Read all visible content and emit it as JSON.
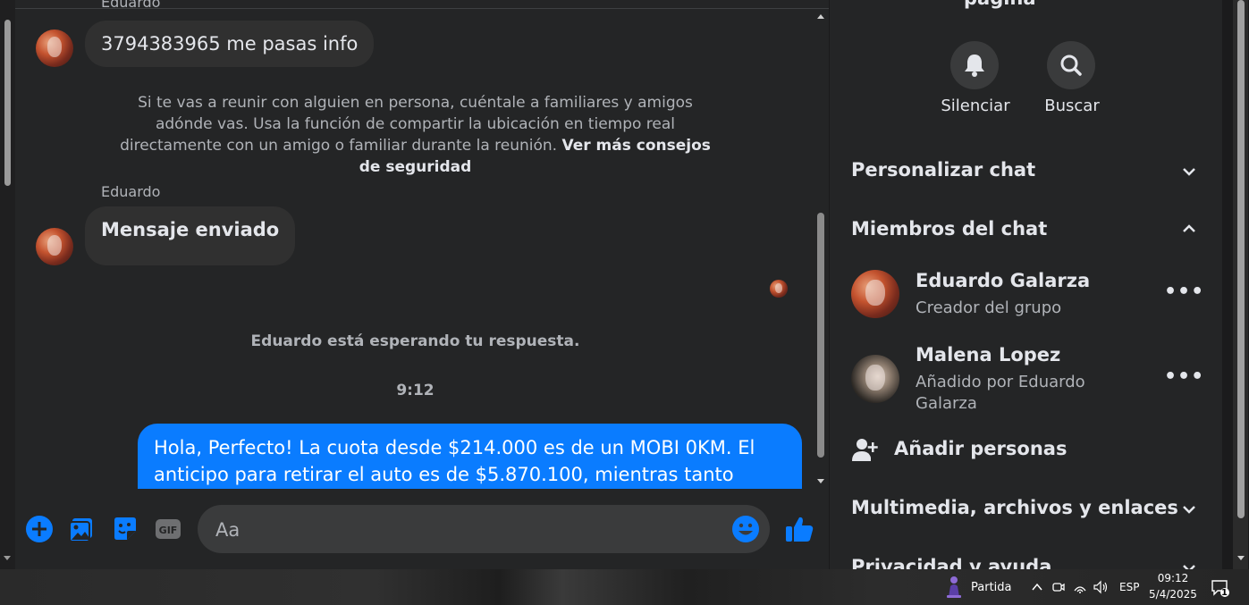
{
  "chat": {
    "top_sender_partial": "Eduardo",
    "msg1": "3794383965 me pasas info",
    "safety_notice_text": "Si te vas a reunir con alguien en persona, cuéntale a familiares y amigos adónde vas. Usa la función de compartir la ubicación en tiempo real directamente con un amigo o familiar durante la reunión.",
    "safety_link": "Ver más consejos de seguridad",
    "sender2": "Eduardo",
    "msg2": "Mensaje enviado",
    "waiting_text": "Eduardo está esperando tu respuesta.",
    "timestamp": "9:12",
    "outgoing_msg": "Hola, Perfecto! La cuota desde $214.000 es de un MOBI 0KM. El anticipo para retirar el auto es de $5.870.100, mientras tanto podes ir",
    "input_placeholder": "Aa",
    "colors": {
      "accent": "#0a7cff",
      "bubble_in": "#303030",
      "background": "#242526"
    }
  },
  "panel": {
    "top_partial": "página",
    "mute_label": "Silenciar",
    "search_label": "Buscar",
    "customize_chat": "Personalizar chat",
    "chat_members": "Miembros del chat",
    "members": [
      {
        "name": "Eduardo Galarza",
        "role": "Creador del grupo"
      },
      {
        "name": "Malena Lopez",
        "role": "Añadido por Eduardo Galarza"
      }
    ],
    "add_people": "Añadir personas",
    "media_files_links": "Multimedia, archivos y enlaces",
    "privacy_support": "Privacidad y ayuda"
  },
  "taskbar": {
    "weather_label": "Partida",
    "language": "ESP",
    "time": "09:12",
    "date": "5/4/2025",
    "notification_count": "1"
  }
}
